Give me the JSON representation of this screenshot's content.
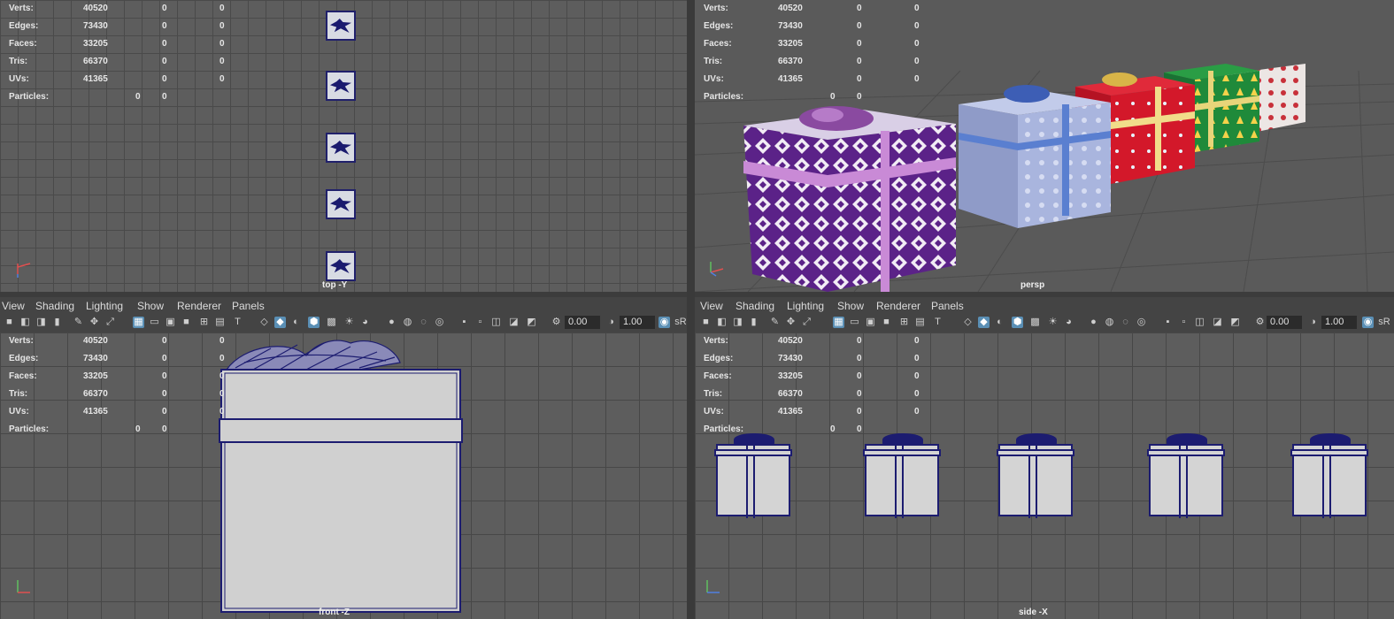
{
  "hud": {
    "rows": [
      {
        "label": "Verts:",
        "v1": "40520",
        "v2": "0",
        "v3": "0"
      },
      {
        "label": "Edges:",
        "v1": "73430",
        "v2": "0",
        "v3": "0"
      },
      {
        "label": "Faces:",
        "v1": "33205",
        "v2": "0",
        "v3": "0"
      },
      {
        "label": "Tris:",
        "v1": "66370",
        "v2": "0",
        "v3": "0"
      },
      {
        "label": "UVs:",
        "v1": "41365",
        "v2": "0",
        "v3": "0"
      }
    ],
    "particles": {
      "label": "Particles:",
      "v1": "0",
      "v2": "0"
    }
  },
  "viewports": {
    "top": {
      "camera": "top -Y"
    },
    "persp": {
      "camera": "persp"
    },
    "front": {
      "camera": "front -Z"
    },
    "side": {
      "camera": "side -X"
    }
  },
  "menubar": {
    "items": [
      "View",
      "Shading",
      "Lighting",
      "Show",
      "Renderer",
      "Panels"
    ]
  },
  "toolbar": {
    "field1": "0.00",
    "field2": "1.00",
    "srgb": "sR"
  },
  "colors": {
    "grid_bg": "#5d5d5d",
    "wire_blue": "#1c1c70",
    "active_icon": "#5a8fb5",
    "gift_purple": "#6a2c8c",
    "gift_blue": "#9aa8d6",
    "gift_red": "#d0182c",
    "gift_green": "#1f8a3a",
    "gift_white": "#e6e0e0"
  },
  "icons": [
    "camera-icon",
    "select-camera-icon",
    "bookmark-icon",
    "grease-pencil-icon",
    "wireframe-icon",
    "smooth-shade-icon",
    "grid-icon",
    "isolate-icon",
    "xray-icon",
    "light-icon",
    "render-icon",
    "exposure-icon",
    "gamma-icon",
    "color-management-icon"
  ]
}
